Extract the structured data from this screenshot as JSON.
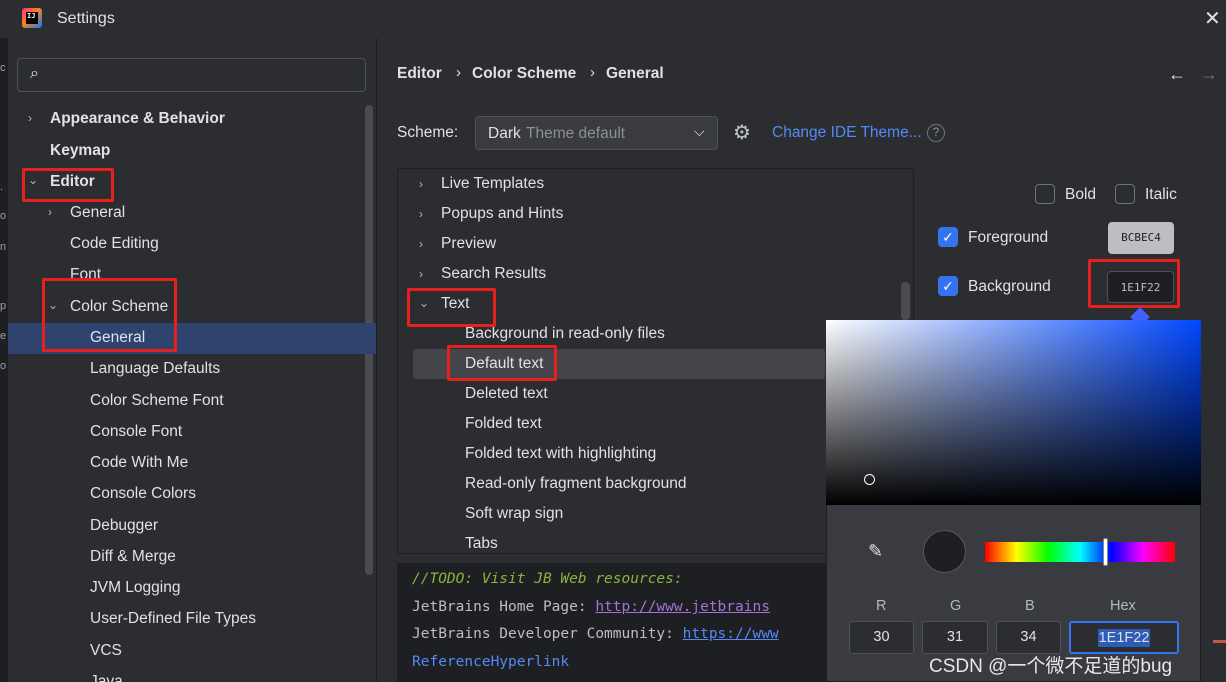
{
  "window": {
    "title": "Settings",
    "close_icon": "close-icon"
  },
  "left_strip": [
    "c",
    ".",
    "o",
    "n",
    "p",
    "e",
    "o"
  ],
  "search": {
    "placeholder": "",
    "value": ""
  },
  "sidebar": {
    "items": [
      {
        "label": "Appearance & Behavior",
        "level": 0,
        "arrow": "›",
        "bold": true
      },
      {
        "label": "Keymap",
        "level": 0,
        "arrow": "",
        "bold": true
      },
      {
        "label": "Editor",
        "level": 0,
        "arrow": "⌄",
        "bold": true
      },
      {
        "label": "General",
        "level": 1,
        "arrow": "›"
      },
      {
        "label": "Code Editing",
        "level": 1,
        "arrow": ""
      },
      {
        "label": "Font",
        "level": 1,
        "arrow": ""
      },
      {
        "label": "Color Scheme",
        "level": 1,
        "arrow": "⌄"
      },
      {
        "label": "General",
        "level": 2,
        "arrow": "",
        "selected": true
      },
      {
        "label": "Language Defaults",
        "level": 2,
        "arrow": ""
      },
      {
        "label": "Color Scheme Font",
        "level": 2,
        "arrow": ""
      },
      {
        "label": "Console Font",
        "level": 2,
        "arrow": ""
      },
      {
        "label": "Code With Me",
        "level": 2,
        "arrow": ""
      },
      {
        "label": "Console Colors",
        "level": 2,
        "arrow": ""
      },
      {
        "label": "Debugger",
        "level": 2,
        "arrow": ""
      },
      {
        "label": "Diff & Merge",
        "level": 2,
        "arrow": ""
      },
      {
        "label": "JVM Logging",
        "level": 2,
        "arrow": ""
      },
      {
        "label": "User-Defined File Types",
        "level": 2,
        "arrow": ""
      },
      {
        "label": "VCS",
        "level": 2,
        "arrow": ""
      },
      {
        "label": "Java",
        "level": 2,
        "arrow": ""
      }
    ]
  },
  "breadcrumb": [
    "Editor",
    "Color Scheme",
    "General"
  ],
  "breadcrumb_sep": "›",
  "nav": {
    "back": "←",
    "forward": "→"
  },
  "scheme": {
    "label": "Scheme:",
    "value_main": "Dark",
    "value_sub": "Theme default",
    "change_theme": "Change IDE Theme...",
    "help": "?"
  },
  "attr_tree": [
    {
      "label": "Live Templates",
      "level": 0,
      "arrow": "›"
    },
    {
      "label": "Popups and Hints",
      "level": 0,
      "arrow": "›"
    },
    {
      "label": "Preview",
      "level": 0,
      "arrow": "›"
    },
    {
      "label": "Search Results",
      "level": 0,
      "arrow": "›"
    },
    {
      "label": "Text",
      "level": 0,
      "arrow": "⌄"
    },
    {
      "label": "Background in read-only files",
      "level": 1,
      "arrow": ""
    },
    {
      "label": "Default text",
      "level": 1,
      "arrow": "",
      "selected": true
    },
    {
      "label": "Deleted text",
      "level": 1,
      "arrow": ""
    },
    {
      "label": "Folded text",
      "level": 1,
      "arrow": ""
    },
    {
      "label": "Folded text with highlighting",
      "level": 1,
      "arrow": ""
    },
    {
      "label": "Read-only fragment background",
      "level": 1,
      "arrow": ""
    },
    {
      "label": "Soft wrap sign",
      "level": 1,
      "arrow": ""
    },
    {
      "label": "Tabs",
      "level": 1,
      "arrow": ""
    }
  ],
  "code_preview": {
    "todo": "//TODO: Visit JB Web resources:",
    "line2_label": "JetBrains Home Page: ",
    "line2_link": "http://www.jetbrains",
    "line3_label": "JetBrains Developer Community: ",
    "line3_link": "https://www",
    "line4": "ReferenceHyperlink"
  },
  "attributes": {
    "bold": {
      "label": "Bold",
      "checked": false
    },
    "italic": {
      "label": "Italic",
      "checked": false
    },
    "foreground": {
      "label": "Foreground",
      "checked": true,
      "swatch": "BCBEC4"
    },
    "background": {
      "label": "Background",
      "checked": true,
      "swatch": "1E1F22"
    }
  },
  "color_picker": {
    "r_label": "R",
    "g_label": "G",
    "b_label": "B",
    "hex_label": "Hex",
    "r": "30",
    "g": "31",
    "b": "34",
    "hex": "1E1F22",
    "preview_color": "#1e1f22"
  },
  "watermark": "CSDN @一个微不足道的bug",
  "colors": {
    "accent": "#3574f0",
    "link": "#548af7",
    "highlight_box": "#e8201d",
    "selection": "#2e436e"
  }
}
